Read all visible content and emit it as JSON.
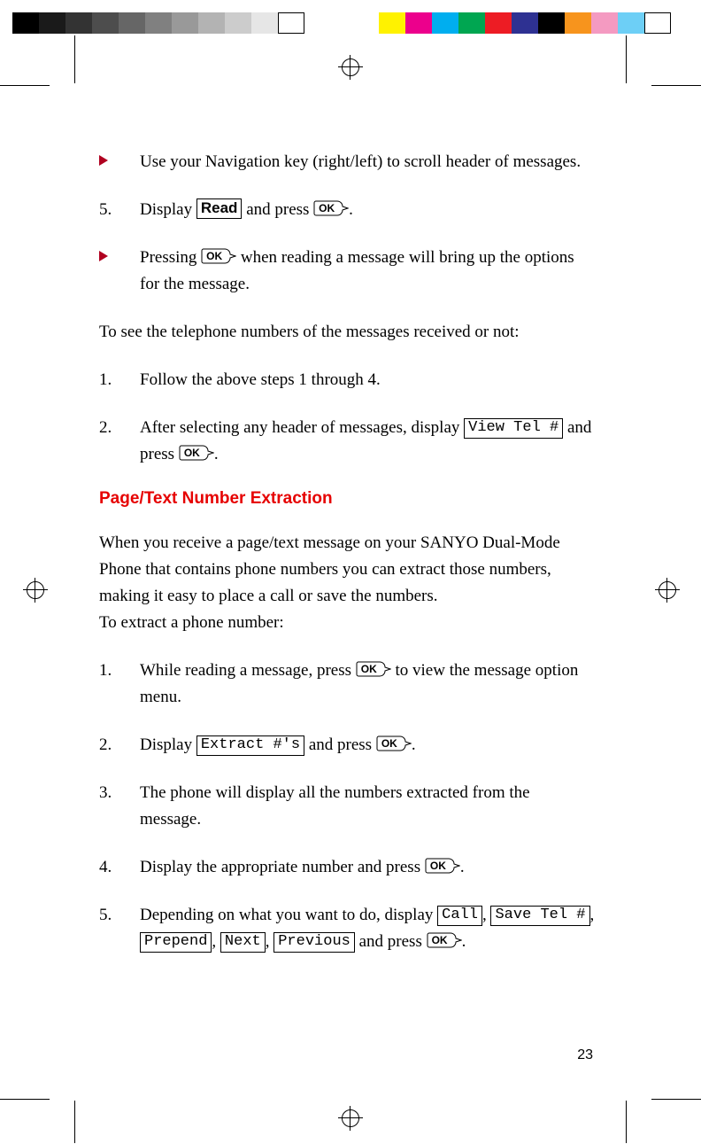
{
  "swatches_gray": [
    "#000000",
    "#1a1a1a",
    "#333333",
    "#4d4d4d",
    "#666666",
    "#808080",
    "#999999",
    "#b3b3b3",
    "#cccccc",
    "#e6e6e6",
    "#ffffff"
  ],
  "swatches_color": [
    "#00aee6",
    "#d4145a",
    "#2e3192",
    "#009245",
    "#ed1c24",
    "#000000",
    "#fbb03b",
    "#f06ea9",
    "#29abe2",
    "#ffffff"
  ],
  "ok_label": "OK",
  "sec1": {
    "b1": "Use your Navigation key (right/left) to scroll header of messages.",
    "s5_num": "5.",
    "s5_a": "Display ",
    "s5_disp": "Read",
    "s5_b": " and press ",
    "s5_c": ".",
    "b2_a": "Pressing ",
    "b2_b": " when reading a message will bring up the options for the message.",
    "p1": "To see the telephone numbers of the messages received or not:",
    "s1_num": "1.",
    "s1": "Follow the above steps 1 through 4.",
    "s2_num": "2.",
    "s2_a": "After selecting any header of messages, display ",
    "s2_disp": "View Tel #",
    "s2_b": " and press ",
    "s2_c": "."
  },
  "heading": "Page/Text Number Extraction",
  "sec2": {
    "intro": "When you receive a page/text message on your SANYO Dual-Mode Phone that contains phone numbers you can extract those numbers, making it easy to place a call or save the numbers.\nTo extract a phone number:",
    "s1_num": "1.",
    "s1_a": "While reading a message, press ",
    "s1_b": " to view the message option menu.",
    "s2_num": "2.",
    "s2_a": "Display ",
    "s2_disp": "Extract #'s",
    "s2_b": " and press ",
    "s2_c": ".",
    "s3_num": "3.",
    "s3": "The phone will display all the numbers extracted from the message.",
    "s4_num": "4.",
    "s4_a": "Display the appropriate number and press ",
    "s4_b": ".",
    "s5_num": "5.",
    "s5_a": "Depending on what you want to do, display ",
    "s5_d1": "Call",
    "s5_d2": "Save Tel #",
    "s5_d3": "Prepend",
    "s5_d4": "Next",
    "s5_d5": "Previous",
    "s5_b": " and press ",
    "s5_c": "."
  },
  "page_number": "23"
}
